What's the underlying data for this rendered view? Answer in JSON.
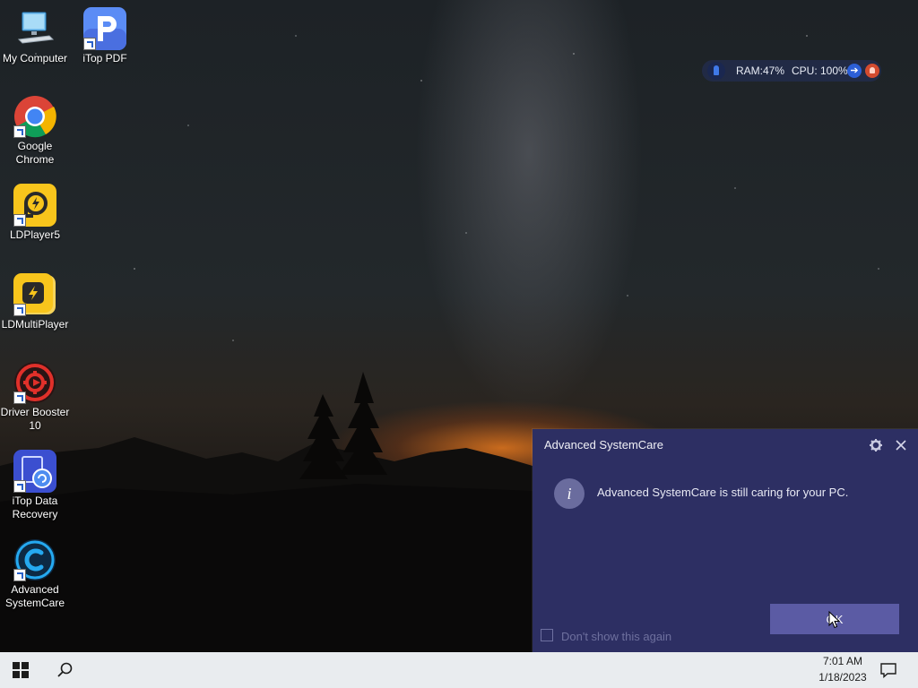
{
  "desktop": {
    "icons": [
      {
        "label": "My Computer",
        "icon": "computer-icon"
      },
      {
        "label": "iTop PDF",
        "icon": "itop-pdf-icon"
      },
      {
        "label": "Google Chrome",
        "icon": "chrome-icon"
      },
      {
        "label": "LDPlayer5",
        "icon": "ldplayer-icon"
      },
      {
        "label": "LDMultiPlayer",
        "icon": "ldmultiplayer-icon"
      },
      {
        "label": "Driver Booster 10",
        "icon": "driver-booster-icon"
      },
      {
        "label": "iTop Data Recovery",
        "icon": "itop-data-recovery-icon"
      },
      {
        "label": "Advanced SystemCare",
        "icon": "advanced-systemcare-icon"
      }
    ]
  },
  "monitor": {
    "ram": "RAM:47%",
    "cpu": "CPU: 100%",
    "go_glyph": "➔",
    "accent": "#2c5fd7",
    "bell_color": "#d34b2f"
  },
  "dialog": {
    "title": "Advanced SystemCare",
    "info_glyph": "i",
    "message": "Advanced SystemCare is still caring for your PC.",
    "checkbox_label": "Don't show this again",
    "checkbox_checked": false,
    "ok_label": "OK",
    "background": "#2d2f63",
    "button_color": "#5b5ba4"
  },
  "taskbar": {
    "time": "7:01 AM",
    "date": "1/18/2023"
  }
}
